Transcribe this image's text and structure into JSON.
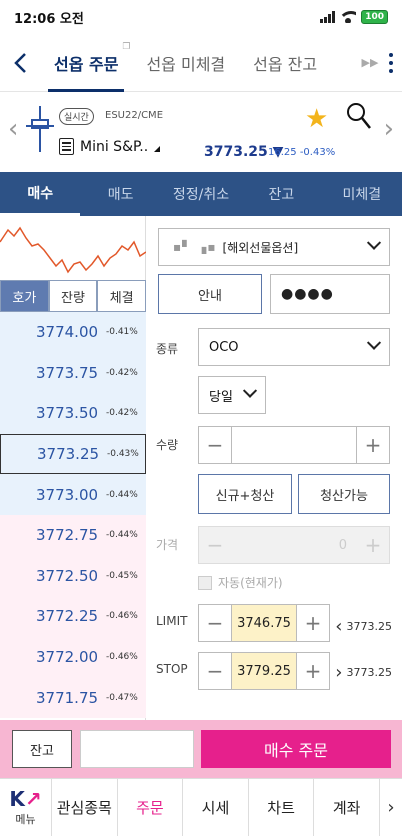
{
  "status": {
    "time": "12:06 오전",
    "battery": "100"
  },
  "topnav": {
    "tabs": [
      {
        "label": "선옵 주문",
        "active": true
      },
      {
        "label": "선옵 미체결",
        "active": false
      },
      {
        "label": "선옵 잔고",
        "active": false
      }
    ]
  },
  "instrument": {
    "badge": "실시간",
    "code": "ESU22/CME",
    "name": "Mini S&P..",
    "price": "3773.25",
    "change_arrow": "▼",
    "change": "16.25",
    "change_pct": "-0.43%"
  },
  "order_tabs": [
    {
      "label": "매수",
      "active": true
    },
    {
      "label": "매도",
      "active": false
    },
    {
      "label": "정정/취소",
      "active": false
    },
    {
      "label": "잔고",
      "active": false
    },
    {
      "label": "미체결",
      "active": false
    }
  ],
  "segments": [
    {
      "label": "호가",
      "active": true
    },
    {
      "label": "잔량",
      "active": false
    },
    {
      "label": "체결",
      "active": false
    }
  ],
  "orderbook": [
    {
      "price": "3774.00",
      "chg": "-0.41%",
      "side": "up"
    },
    {
      "price": "3773.75",
      "chg": "-0.42%",
      "side": "up"
    },
    {
      "price": "3773.50",
      "chg": "-0.42%",
      "side": "up"
    },
    {
      "price": "3773.25",
      "chg": "-0.43%",
      "side": "up",
      "selected": true
    },
    {
      "price": "3773.00",
      "chg": "-0.44%",
      "side": "up"
    },
    {
      "price": "3772.75",
      "chg": "-0.44%",
      "side": "down"
    },
    {
      "price": "3772.50",
      "chg": "-0.45%",
      "side": "down"
    },
    {
      "price": "3772.25",
      "chg": "-0.46%",
      "side": "down"
    },
    {
      "price": "3772.00",
      "chg": "-0.46%",
      "side": "down"
    },
    {
      "price": "3771.75",
      "chg": "-0.47%",
      "side": "down"
    }
  ],
  "form": {
    "account_mask": "▪▘ ▗▪",
    "account_name": "[해외선물옵션]",
    "guide_label": "안내",
    "password": "●●●●",
    "type_label": "종류",
    "type_value": "OCO",
    "term_value": "당일",
    "qty_label": "수량",
    "qty_value": "",
    "new_close_label": "신규+청산",
    "closable_label": "청산가능",
    "price_label": "가격",
    "price_value": "0",
    "auto_label": "자동(현재가)",
    "limit_label": "LIMIT",
    "limit_value": "3746.75",
    "limit_ref": "3773.25",
    "stop_label": "STOP",
    "stop_value": "3779.25",
    "stop_ref": "3773.25"
  },
  "orderbar": {
    "jango_label": "잔고",
    "buy_label": "매수 주문"
  },
  "bottomnav": {
    "logo_label": "메뉴",
    "items": [
      {
        "label": "관심종목",
        "active": false
      },
      {
        "label": "주문",
        "active": true
      },
      {
        "label": "시세",
        "active": false
      },
      {
        "label": "차트",
        "active": false
      },
      {
        "label": "계좌",
        "active": false
      }
    ]
  },
  "colors": {
    "navy": "#0c2f6a",
    "tabbar": "#2d5286",
    "pink": "#e6208c",
    "up_bg": "#e8f2fc",
    "down_bg": "#fff0f6",
    "star": "#f3b41c"
  }
}
